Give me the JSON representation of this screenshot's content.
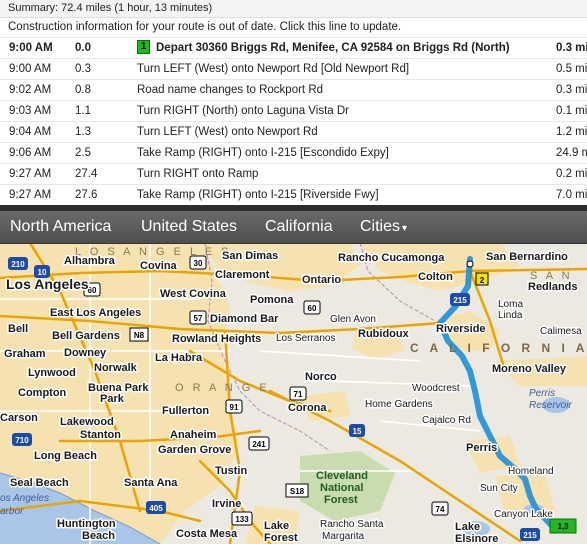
{
  "directions": {
    "summary": "Summary:  72.4 miles (1 hour, 13 minutes)",
    "update_line": "Construction information for your route is out of date.  Click this line to update.",
    "steps": [
      {
        "time": "9:00 AM",
        "cumulative": "0.0",
        "badge": "1",
        "text": "Depart 30360 Briggs Rd, Menifee, CA 92584 on Briggs Rd (North)",
        "distance": "0.3 mi"
      },
      {
        "time": "9:00 AM",
        "cumulative": "0.3",
        "text": "Turn LEFT (West) onto Newport Rd [Old Newport Rd]",
        "distance": "0.5 mi"
      },
      {
        "time": "9:02 AM",
        "cumulative": "0.8",
        "text": "Road name changes to Rockport Rd",
        "distance": "0.3 mi"
      },
      {
        "time": "9:03 AM",
        "cumulative": "1.1",
        "text": "Turn RIGHT (North) onto Laguna Vista Dr",
        "distance": "0.1 mi"
      },
      {
        "time": "9:04 AM",
        "cumulative": "1.3",
        "text": "Turn LEFT (West) onto Newport Rd",
        "distance": "1.2 mi"
      },
      {
        "time": "9:06 AM",
        "cumulative": "2.5",
        "text": "Take Ramp (RIGHT) onto I-215 [Escondido Expy]",
        "distance": "24.9 mi"
      },
      {
        "time": "9:27 AM",
        "cumulative": "27.4",
        "text": "Turn RIGHT onto Ramp",
        "distance": "0.2 mi"
      },
      {
        "time": "9:27 AM",
        "cumulative": "27.6",
        "text": "Take Ramp (RIGHT) onto I-215 [Riverside Fwy]",
        "distance": "7.0 mi"
      }
    ]
  },
  "map_nav": {
    "items": [
      "North America",
      "United States",
      "California"
    ],
    "cities_label": "Cities",
    "cities_arrow": "▾"
  },
  "map": {
    "region_labels": {
      "los_angeles": "L O S  A N G E L E S",
      "san": "S A N",
      "california": "C A L I F O R N I A",
      "orange": "O R A N G E"
    },
    "cities_large": {
      "los_angeles": "Los Angeles"
    },
    "cities": {
      "san_dimas": "San Dimas",
      "rancho_cucamonga": "Rancho Cucamonga",
      "san_bernardino": "San Bernardino",
      "alhambra": "Alhambra",
      "covina": "Covina",
      "claremont": "Claremont",
      "ontario": "Ontario",
      "colton": "Colton",
      "redlands": "Redlands",
      "west_covina": "West Covina",
      "pomona": "Pomona",
      "east_los_angeles": "East Los Angeles",
      "diamond_bar": "Diamond Bar",
      "glen_avon": "Glen Avon",
      "riverside": "Riverside",
      "bell": "Bell",
      "bell_gardens": "Bell Gardens",
      "rowland_heights": "Rowland Heights",
      "rubidoux": "Rubidoux",
      "graham": "Graham",
      "downey": "Downey",
      "la_habra": "La Habra",
      "los_serranos": "Los Serranos",
      "lynwood": "Lynwood",
      "norwalk": "Norwalk",
      "norco": "Norco",
      "moreno_valley": "Moreno Valley",
      "compton": "Compton",
      "buena_park": "Buena Park",
      "woodcrest": "Woodcrest",
      "fullerton": "Fullerton",
      "carson": "Carson",
      "lakewood": "Lakewood",
      "corona": "Corona",
      "home_gardens": "Home Gardens",
      "stanton": "Stanton",
      "anaheim": "Anaheim",
      "cajalco_rd": "Cajalco Rd",
      "perris": "Perris",
      "long_beach": "Long Beach",
      "garden_grove": "Garden Grove",
      "tustin": "Tustin",
      "homeland": "Homeland",
      "seal_beach": "Seal Beach",
      "santa_ana": "Santa Ana",
      "sun_city": "Sun City",
      "irvine": "Irvine",
      "canyon_lake": "Canyon Lake",
      "huntington": "Huntington",
      "beach": "Beach",
      "costa_mesa": "Costa Mesa",
      "lake": "Lake",
      "forest": "Forest",
      "rancho_santa": "Rancho Santa",
      "margarita": "Margarita",
      "lake_elsinore_1": "Lake",
      "lake_elsinore_2": "Elsinore",
      "loma_linda_1": "Loma",
      "loma_linda_2": "Linda",
      "calimesa": "Calimesa",
      "park": "Park"
    },
    "water": {
      "perris_1": "Perris",
      "perris_2": "Reservoir",
      "los_angeles_harbor_1": "os Angeles",
      "los_angeles_harbor_2": "arbor"
    },
    "forest_labels": [
      "Cleveland",
      "National",
      "Forest"
    ],
    "shields": {
      "i10": "10",
      "i210": "210",
      "r30": "30",
      "i60_a": "60",
      "i60_b": "60",
      "r71": "71",
      "r91": "91",
      "i15": "15",
      "i215_a": "215",
      "i215_b": "215",
      "n8": "N8",
      "r241": "241",
      "s18": "S18",
      "i405": "405",
      "r133": "133",
      "r74": "74",
      "i710": "710",
      "r57": "57"
    },
    "markers": {
      "start_end": "1,3",
      "waypoint": "2"
    },
    "colors": {
      "route": "#1f8fd6",
      "urban": "#f6e2b0",
      "land": "#eceae0",
      "highway": "#e8a400",
      "water": "#a9c5e8"
    }
  }
}
